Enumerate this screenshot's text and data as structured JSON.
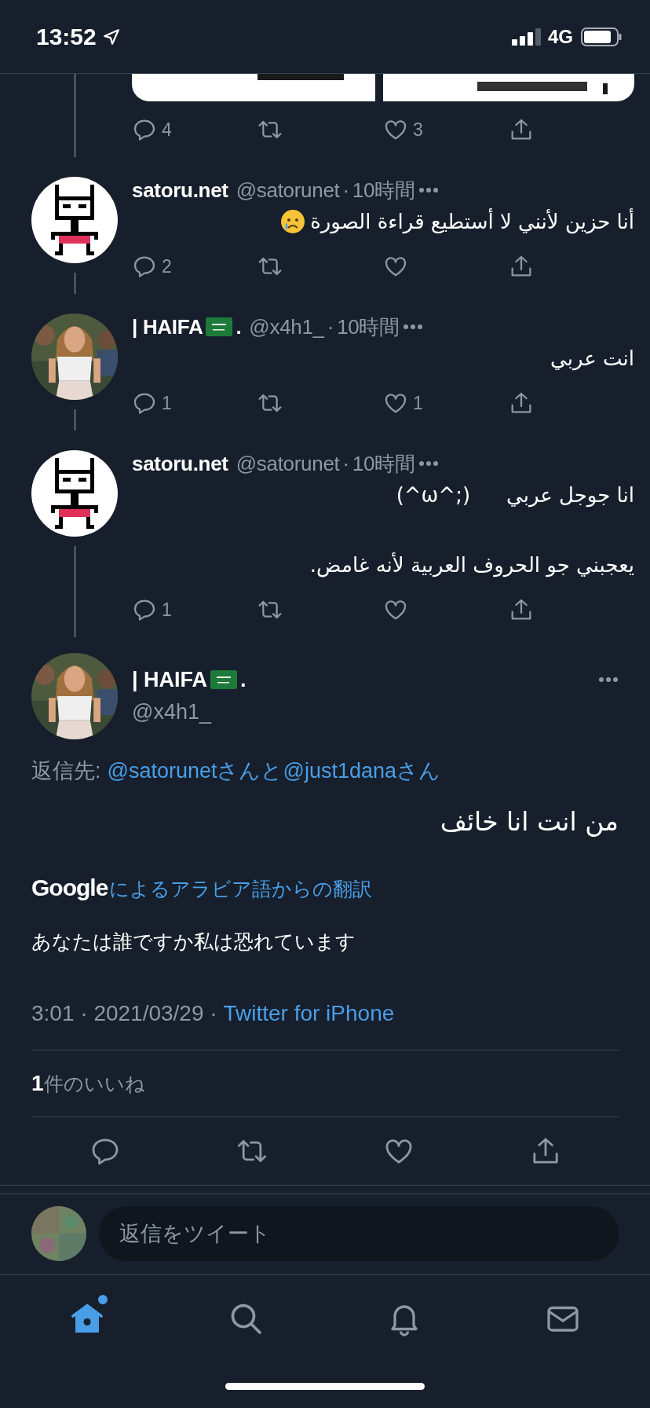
{
  "status_bar": {
    "time": "13:52",
    "network": "4G"
  },
  "thread": [
    {
      "kind": "media-tail",
      "media": {
        "kind": "picture"
      },
      "actions": [
        {
          "kind": "reply",
          "count": "4"
        },
        {
          "kind": "retweet"
        },
        {
          "kind": "like",
          "count": "3"
        },
        {
          "kind": "share"
        }
      ]
    },
    {
      "kind": "tweet",
      "avatar": {
        "kind": "icon"
      },
      "name": "satoru.net",
      "handle": "@satorunet",
      "separator": "·",
      "time": "10時間",
      "lines": [
        {
          "kind": "emoji",
          "text": "أنا حزين لأنني لا أستطيع قراءة الصورة"
        }
      ],
      "actions": [
        {
          "kind": "reply",
          "count": "2"
        },
        {
          "kind": "retweet"
        },
        {
          "kind": "like"
        },
        {
          "kind": "share"
        }
      ]
    },
    {
      "kind": "tweet",
      "avatar": {
        "kind": "picture"
      },
      "name": "| HAIFA",
      "flag": true,
      "name_suffix": ".",
      "handle": "@x4h1_",
      "separator": "·",
      "time": "10時間",
      "lines": [
        {
          "kind": "plain",
          "text": "انت عربي"
        }
      ],
      "actions": [
        {
          "kind": "reply",
          "count": "1"
        },
        {
          "kind": "retweet"
        },
        {
          "kind": "like",
          "count": "1"
        },
        {
          "kind": "share"
        }
      ]
    },
    {
      "kind": "tweet",
      "avatar": {
        "kind": "icon"
      },
      "name": "satoru.net",
      "handle": "@satorunet",
      "separator": "·",
      "time": "10時間",
      "lines": [
        {
          "kind": "aside",
          "text": "انا جوجل عربي",
          "aside": "(^ω^;)"
        },
        {
          "kind": "plain",
          "text": "يعجبني جو الحروف العربية لأنه غامض."
        }
      ],
      "actions": [
        {
          "kind": "reply",
          "count": "1"
        },
        {
          "kind": "retweet"
        },
        {
          "kind": "like"
        },
        {
          "kind": "share"
        }
      ]
    }
  ],
  "main_tweet": {
    "avatar": {
      "kind": "picture"
    },
    "name": "| HAIFA",
    "flag": true,
    "name_suffix": ".",
    "handle": "@x4h1_",
    "reply_to_label": "返信先:",
    "reply_to": "@satorunetさんと@just1danaさん",
    "text": "من انت انا خائف",
    "translation_brand": "Google",
    "translation_note": "によるアラビア語からの翻訳",
    "translation": "あなたは誰ですか私は恐れています",
    "timestamp": "3:01 · 2021/03/29 · ",
    "source": "Twitter for iPhone",
    "likes_count": "1",
    "likes_label": "件のいいね",
    "actions": [
      {
        "kind": "reply"
      },
      {
        "kind": "retweet"
      },
      {
        "kind": "like"
      },
      {
        "kind": "share"
      }
    ]
  },
  "reply_bar": {
    "placeholder": "返信をツイート"
  },
  "tab_bar": [
    {
      "kind": "home",
      "selected": true,
      "dot": true
    },
    {
      "kind": "search",
      "selected": false
    },
    {
      "kind": "notifications",
      "selected": false
    },
    {
      "kind": "messages",
      "selected": false
    }
  ]
}
